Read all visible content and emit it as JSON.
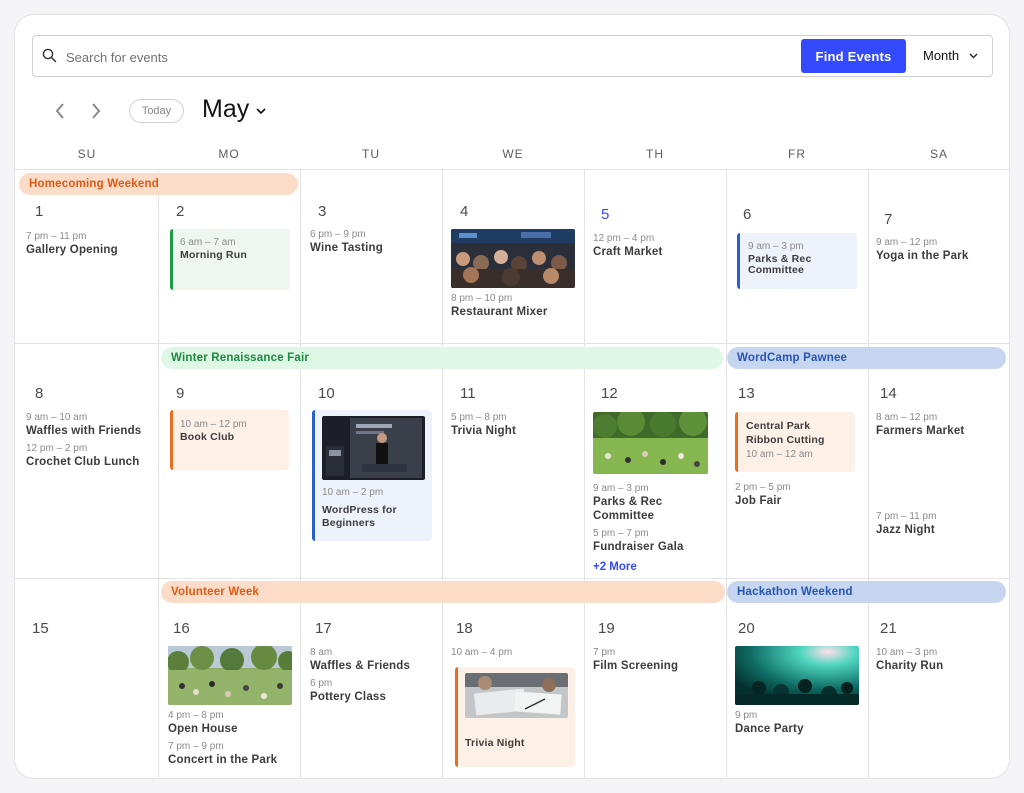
{
  "search": {
    "placeholder": "Search for events",
    "button": "Find Events",
    "view": "Month"
  },
  "nav": {
    "today": "Today",
    "month": "May"
  },
  "weekdays": [
    "SU",
    "MO",
    "TU",
    "WE",
    "TH",
    "FR",
    "SA"
  ],
  "bands": {
    "homecoming": "Homecoming Weekend",
    "winter_fair": "Winter Renaissance Fair",
    "wordcamp": "WordCamp Pawnee",
    "volunteer": "Volunteer Week",
    "hackathon": "Hackathon Weekend"
  },
  "days": {
    "d1": {
      "num": "1",
      "e1_time": "7 pm – 11 pm",
      "e1_title": "Gallery Opening"
    },
    "d2": {
      "num": "2",
      "e1_time": "6 am – 7 am",
      "e1_title": "Morning Run"
    },
    "d3": {
      "num": "3",
      "e1_time": "6 pm – 9 pm",
      "e1_title": "Wine Tasting"
    },
    "d4": {
      "num": "4",
      "e1_time": "8 pm – 10 pm",
      "e1_title": "Restaurant Mixer"
    },
    "d5": {
      "num": "5",
      "e1_time": "12 pm – 4 pm",
      "e1_title": "Craft Market"
    },
    "d6": {
      "num": "6",
      "e1_time": "9 am – 3 pm",
      "e1_title_1": "Parks & Rec",
      "e1_title_2": "Committee"
    },
    "d7": {
      "num": "7",
      "e1_time": "9 am – 12 pm",
      "e1_title": "Yoga in the Park"
    },
    "d8": {
      "num": "8",
      "e1_time": "9 am – 10 am",
      "e1_title": "Waffles with Friends",
      "e2_time": "12 pm – 2 pm",
      "e2_title": "Crochet Club Lunch"
    },
    "d9": {
      "num": "9",
      "e1_time": "10 am – 12 pm",
      "e1_title": "Book Club"
    },
    "d10": {
      "num": "10",
      "e1_time": "10 am – 2 pm",
      "e1_title_1": "WordPress for",
      "e1_title_2": "Beginners"
    },
    "d11": {
      "num": "11",
      "e1_time": "5 pm – 8 pm",
      "e1_title": "Trivia Night"
    },
    "d12": {
      "num": "12",
      "e1_time": "9 am – 3 pm",
      "e1_title_1": "Parks & Rec",
      "e1_title_2": "Committee",
      "e2_time": "5 pm – 7 pm",
      "e2_title": "Fundraiser Gala",
      "more": "+2 More"
    },
    "d13": {
      "num": "13",
      "e1_title_1": "Central Park",
      "e1_title_2": "Ribbon Cutting",
      "e1_time": "10 am – 12 am",
      "e2_time": "2 pm – 5 pm",
      "e2_title": "Job Fair"
    },
    "d14": {
      "num": "14",
      "e1_time": "8 am – 12 pm",
      "e1_title": "Farmers Market",
      "e2_time": "7 pm – 11 pm",
      "e2_title": "Jazz Night"
    },
    "d15": {
      "num": "15"
    },
    "d16": {
      "num": "16",
      "e1_time": "4 pm – 8 pm",
      "e1_title": "Open House",
      "e2_time": "7 pm – 9 pm",
      "e2_title": "Concert in the Park"
    },
    "d17": {
      "num": "17",
      "e1_time": "8 am",
      "e1_title": "Waffles & Friends",
      "e2_time": "6 pm",
      "e2_title": "Pottery Class"
    },
    "d18": {
      "num": "18",
      "e1_time": "10 am – 4 pm",
      "e1_title": "Trivia Night"
    },
    "d19": {
      "num": "19",
      "e1_time": "7 pm",
      "e1_title": "Film Screening"
    },
    "d20": {
      "num": "20",
      "e1_time": "9 pm",
      "e1_title": "Dance Party"
    },
    "d21": {
      "num": "21",
      "e1_time": "10 am – 3 pm",
      "e1_title": "Charity Run"
    }
  },
  "colors": {
    "accent": "#334aff",
    "green": "#1e9b44",
    "orange": "#e96e24",
    "blue": "#2d5fc9"
  }
}
